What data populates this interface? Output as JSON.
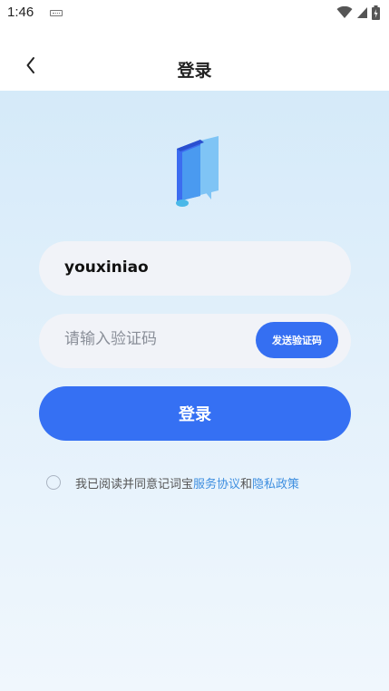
{
  "status_bar": {
    "time": "1:46"
  },
  "header": {
    "title": "登录"
  },
  "form": {
    "username_value": "youxiniao",
    "code_placeholder": "请输入验证码",
    "send_code_label": "发送验证码",
    "login_label": "登录"
  },
  "agreement": {
    "prefix": "我已阅读并同意记词宝",
    "service_link": "服务协议",
    "and": "和",
    "privacy_link": "隐私政策"
  },
  "colors": {
    "primary": "#3570f3",
    "link": "#3f8fe0",
    "background_top": "#d5eaf9",
    "input_bg": "#f1f3f8"
  },
  "icons": [
    "back-chevron-icon",
    "book-logo-icon",
    "wifi-icon",
    "signal-icon",
    "battery-icon",
    "keyboard-icon"
  ]
}
